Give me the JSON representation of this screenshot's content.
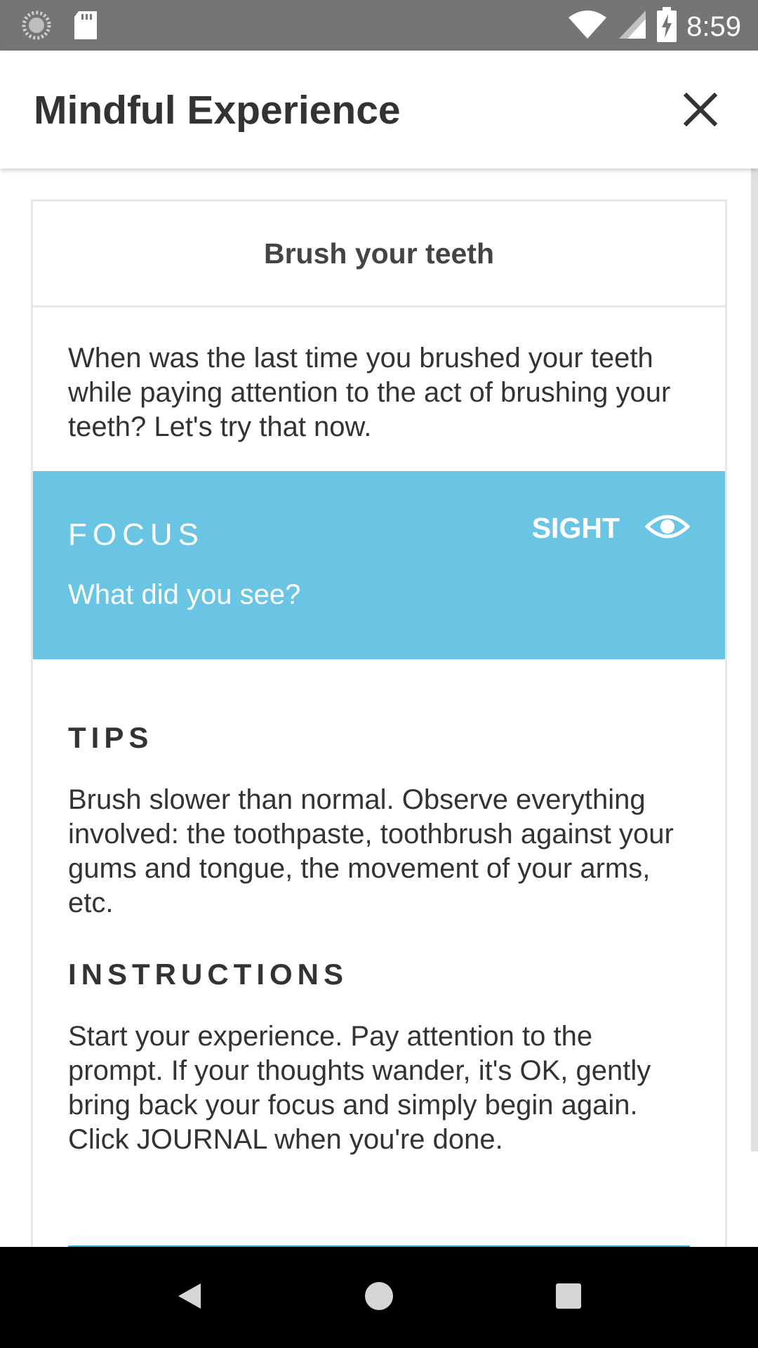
{
  "status_bar": {
    "time": "8:59",
    "icons": [
      "loading-circle-icon",
      "sd-card-icon",
      "wifi-icon",
      "signal-icon",
      "battery-charging-icon"
    ]
  },
  "app_bar": {
    "title": "Mindful Experience",
    "close_icon": "close-icon"
  },
  "card": {
    "title": "Brush your teeth",
    "intro": "When was the last time you brushed your teeth while paying attention to the act of brushing your teeth? Let's try that now.",
    "focus": {
      "label": "FOCUS",
      "question": "What did you see?",
      "sense": "SIGHT",
      "sense_icon": "eye-icon",
      "color": "#6ac5e4"
    },
    "tips": {
      "heading": "TIPS",
      "body": "Brush slower than normal. Observe everything involved: the toothpaste, toothbrush against your gums and tongue, the movement of your arms, etc."
    },
    "instructions": {
      "heading": "INSTRUCTIONS",
      "body": "Start your experience. Pay attention to the prompt. If your thoughts wander, it's OK, gently bring back your focus and simply begin again. Click JOURNAL when you're done."
    },
    "accent_color": "#2aa7d6"
  },
  "nav_bar": {
    "buttons": [
      "back-icon",
      "home-icon",
      "recents-icon"
    ]
  }
}
